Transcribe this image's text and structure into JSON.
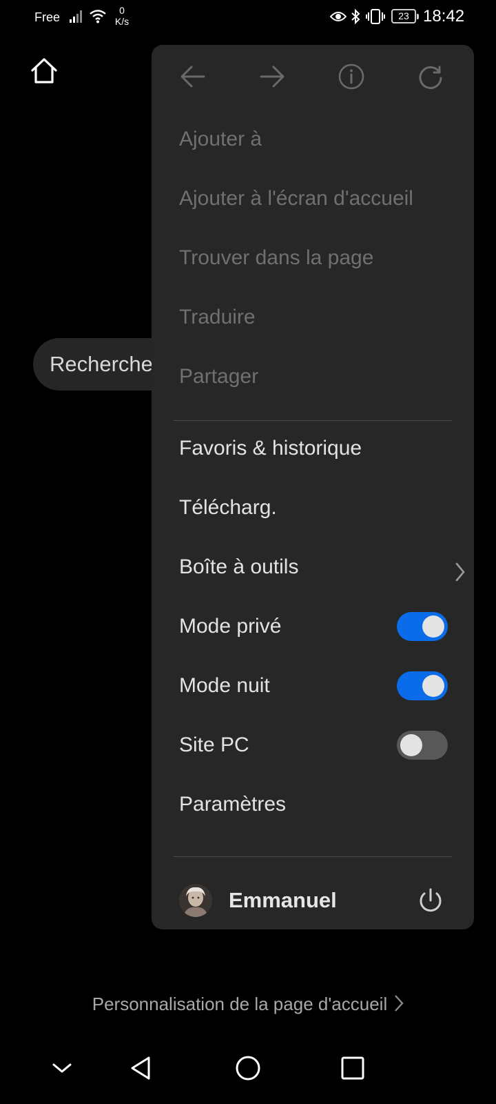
{
  "status_bar": {
    "carrier": "Free",
    "net_speed_value": "0",
    "net_speed_unit": "K/s",
    "battery": "23",
    "time": "18:42",
    "icons": [
      "signal-icon",
      "wifi-icon",
      "eye-comfort-icon",
      "bluetooth-icon",
      "vibrate-icon",
      "battery-icon"
    ]
  },
  "background_page": {
    "search_placeholder": "Recherche",
    "customize_link": "Personnalisation de la page d'accueil"
  },
  "menu": {
    "nav_icons": [
      "back-arrow-icon",
      "forward-arrow-icon",
      "info-icon",
      "refresh-icon"
    ],
    "disabled_items": [
      "Ajouter à",
      "Ajouter à l'écran d'accueil",
      "Trouver dans la page",
      "Traduire",
      "Partager"
    ],
    "items": {
      "bookmarks": "Favoris & historique",
      "downloads": "Télécharg.",
      "toolbox": "Boîte à outils",
      "private_mode": "Mode privé",
      "night_mode": "Mode nuit",
      "desktop_site": "Site PC",
      "settings": "Paramètres"
    },
    "toggles": {
      "private_mode": true,
      "night_mode": true,
      "desktop_site": false
    },
    "account": {
      "name": "Emmanuel"
    }
  },
  "colors": {
    "background": "#000000",
    "panel": "#272727",
    "toggle_on": "#0a6ce8",
    "toggle_off": "#585858",
    "disabled_text": "#707070"
  }
}
